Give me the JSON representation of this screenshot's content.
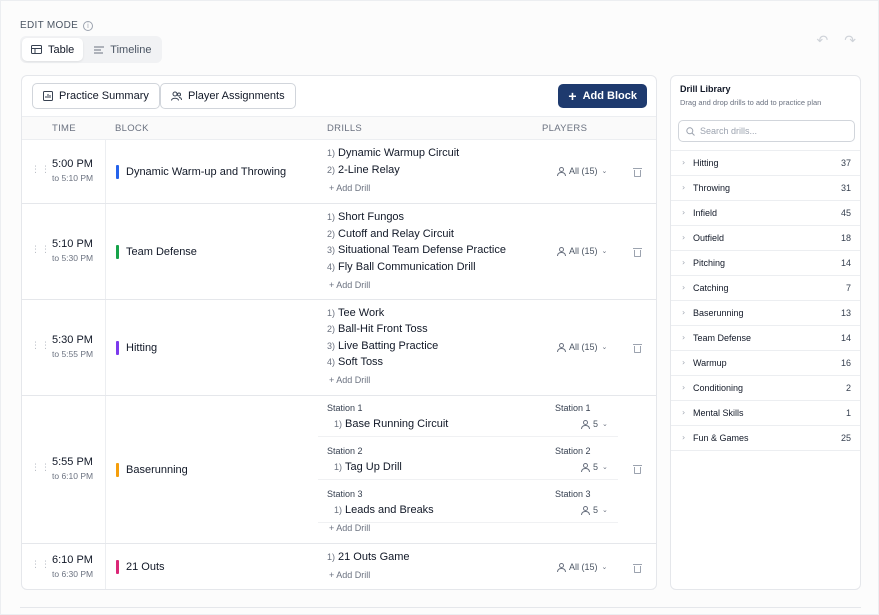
{
  "header": {
    "edit_mode": "EDIT MODE",
    "view_toggle": {
      "table": "Table",
      "timeline": "Timeline"
    },
    "undo_icon": "↶",
    "redo_icon": "↷"
  },
  "toolbar": {
    "practice_summary": "Practice Summary",
    "player_assignments": "Player Assignments",
    "add_block": "Add Block"
  },
  "table": {
    "headers": {
      "time": "TIME",
      "block": "BLOCK",
      "drills": "DRILLS",
      "players": "PLAYERS"
    },
    "add_drill": "+ Add Drill",
    "blocks": [
      {
        "start": "5:00 PM",
        "end": "to 5:10 PM",
        "name": "Dynamic Warm-up and Throwing",
        "color": "#2563eb",
        "players": "All (15)",
        "drills": [
          "Dynamic Warmup Circuit",
          "2-Line Relay"
        ]
      },
      {
        "start": "5:10 PM",
        "end": "to 5:30 PM",
        "name": "Team Defense",
        "color": "#16a34a",
        "players": "All (15)",
        "drills": [
          "Short Fungos",
          "Cutoff and Relay Circuit",
          "Situational Team Defense Practice",
          "Fly Ball Communication Drill"
        ]
      },
      {
        "start": "5:30 PM",
        "end": "to 5:55 PM",
        "name": "Hitting",
        "color": "#7c3aed",
        "players": "All (15)",
        "drills": [
          "Tee Work",
          "Ball-Hit Front Toss",
          "Live Batting Practice",
          "Soft Toss"
        ]
      },
      {
        "start": "5:55 PM",
        "end": "to 6:10 PM",
        "name": "Baserunning",
        "color": "#f59e0b",
        "stations": [
          {
            "label": "Station 1",
            "drill": "Base Running Circuit",
            "players": "5"
          },
          {
            "label": "Station 2",
            "drill": "Tag Up Drill",
            "players": "5"
          },
          {
            "label": "Station 3",
            "drill": "Leads and Breaks",
            "players": "5"
          }
        ]
      },
      {
        "start": "6:10 PM",
        "end": "to 6:30 PM",
        "name": "21 Outs",
        "color": "#db2777",
        "players": "All (15)",
        "drills": [
          "21 Outs Game"
        ]
      }
    ]
  },
  "library": {
    "title": "Drill Library",
    "subtitle": "Drag and drop drills to add to practice plan",
    "search_placeholder": "Search drills...",
    "categories": [
      {
        "name": "Hitting",
        "count": "37"
      },
      {
        "name": "Throwing",
        "count": "31"
      },
      {
        "name": "Infield",
        "count": "45"
      },
      {
        "name": "Outfield",
        "count": "18"
      },
      {
        "name": "Pitching",
        "count": "14"
      },
      {
        "name": "Catching",
        "count": "7"
      },
      {
        "name": "Baserunning",
        "count": "13"
      },
      {
        "name": "Team Defense",
        "count": "14"
      },
      {
        "name": "Warmup",
        "count": "16"
      },
      {
        "name": "Conditioning",
        "count": "2"
      },
      {
        "name": "Mental Skills",
        "count": "1"
      },
      {
        "name": "Fun & Games",
        "count": "25"
      }
    ]
  }
}
